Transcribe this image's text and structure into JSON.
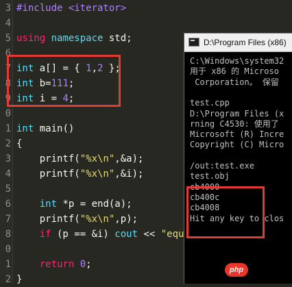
{
  "editor": {
    "lines": [
      {
        "num": "3",
        "html": [
          {
            "t": "#include <iterator>",
            "c": "kw-purple"
          }
        ]
      },
      {
        "num": "4",
        "html": []
      },
      {
        "num": "5",
        "html": [
          {
            "t": "using",
            "c": "kw-pink"
          },
          {
            "t": " namespace ",
            "c": "kw-blue"
          },
          {
            "t": "std",
            "c": ""
          },
          {
            "t": ";",
            "c": ""
          }
        ]
      },
      {
        "num": "6",
        "html": []
      },
      {
        "num": "7",
        "html": [
          {
            "t": "int",
            "c": "kw-blue"
          },
          {
            "t": " a[] = { ",
            "c": ""
          },
          {
            "t": "1",
            "c": "num"
          },
          {
            "t": ",",
            "c": ""
          },
          {
            "t": "2",
            "c": "num"
          },
          {
            "t": " };",
            "c": ""
          }
        ]
      },
      {
        "num": "8",
        "html": [
          {
            "t": "int",
            "c": "kw-blue"
          },
          {
            "t": " b=",
            "c": ""
          },
          {
            "t": "111",
            "c": "num"
          },
          {
            "t": ";",
            "c": ""
          }
        ]
      },
      {
        "num": "9",
        "html": [
          {
            "t": "int",
            "c": "kw-blue"
          },
          {
            "t": " i = ",
            "c": ""
          },
          {
            "t": "4",
            "c": "num"
          },
          {
            "t": ";",
            "c": ""
          }
        ]
      },
      {
        "num": "0",
        "html": []
      },
      {
        "num": "1",
        "html": [
          {
            "t": "int",
            "c": "kw-blue"
          },
          {
            "t": " main()",
            "c": ""
          }
        ]
      },
      {
        "num": "2",
        "html": [
          {
            "t": "{",
            "c": ""
          }
        ]
      },
      {
        "num": "3",
        "html": [
          {
            "t": "    printf(",
            "c": ""
          },
          {
            "t": "\"%x\\n\"",
            "c": "str"
          },
          {
            "t": ",&a);",
            "c": ""
          }
        ]
      },
      {
        "num": "4",
        "html": [
          {
            "t": "    printf(",
            "c": ""
          },
          {
            "t": "\"%x\\n\"",
            "c": "str"
          },
          {
            "t": ",&i);",
            "c": ""
          }
        ]
      },
      {
        "num": "5",
        "html": []
      },
      {
        "num": "6",
        "html": [
          {
            "t": "    ",
            "c": ""
          },
          {
            "t": "int",
            "c": "kw-blue"
          },
          {
            "t": " *p = end(a);",
            "c": ""
          }
        ]
      },
      {
        "num": "7",
        "html": [
          {
            "t": "    printf(",
            "c": ""
          },
          {
            "t": "\"%x\\n\"",
            "c": "str"
          },
          {
            "t": ",p);",
            "c": ""
          }
        ]
      },
      {
        "num": "8",
        "html": [
          {
            "t": "    ",
            "c": ""
          },
          {
            "t": "if",
            "c": "kw-pink"
          },
          {
            "t": " (p == &i) ",
            "c": ""
          },
          {
            "t": "cout",
            "c": "kw-blue"
          },
          {
            "t": " << ",
            "c": ""
          },
          {
            "t": "\"equ\"",
            "c": "str"
          }
        ]
      },
      {
        "num": "0",
        "html": []
      },
      {
        "num": "1",
        "html": [
          {
            "t": "    ",
            "c": ""
          },
          {
            "t": "return",
            "c": "kw-pink"
          },
          {
            "t": " ",
            "c": ""
          },
          {
            "t": "0",
            "c": "num"
          },
          {
            "t": ";",
            "c": ""
          }
        ]
      },
      {
        "num": "2",
        "html": [
          {
            "t": "}",
            "c": ""
          }
        ]
      }
    ]
  },
  "console": {
    "title": "D:\\Program Files (x86)",
    "lines": [
      "C:\\Windows\\system32",
      "用于 x86 的 Microso",
      " Corporation。 保留",
      "",
      "test.cpp",
      "D:\\Program Files (x",
      "rning C4530: 使用了",
      "Microsoft (R) Incre",
      "Copyright (C) Micro",
      "",
      "/out:test.exe",
      "test.obj",
      "cb4000",
      "cb400c",
      "cb4008",
      "Hit any key to clos"
    ]
  },
  "watermark": {
    "text": "php"
  }
}
